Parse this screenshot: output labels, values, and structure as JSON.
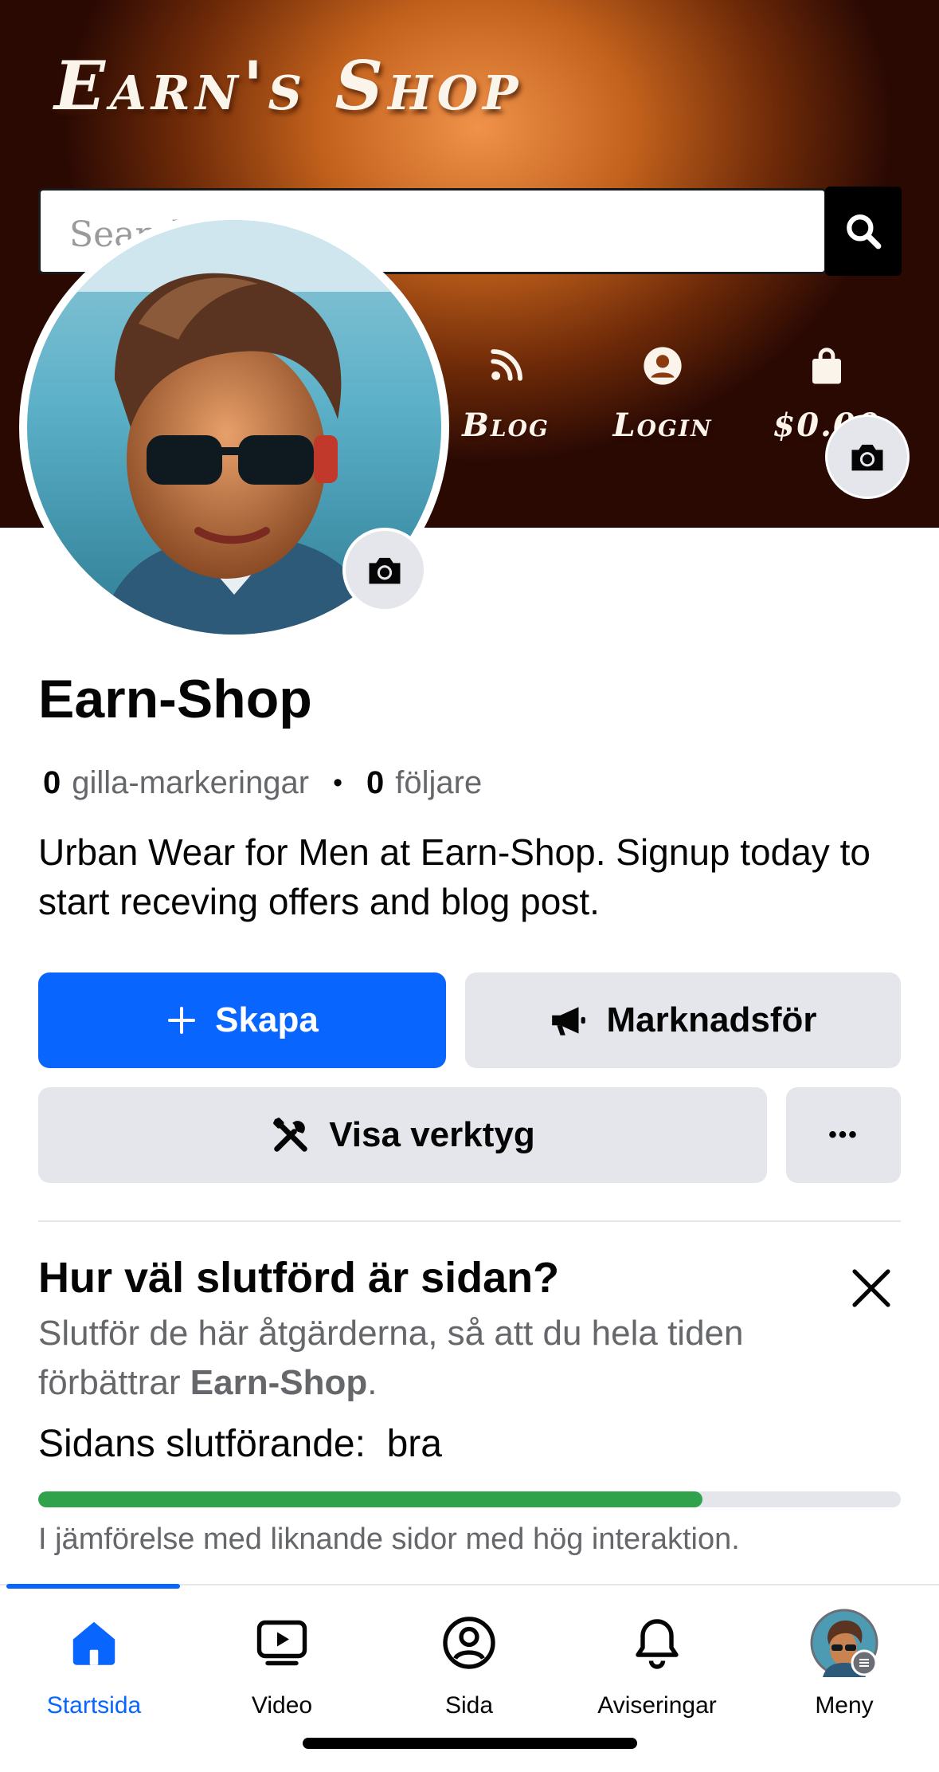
{
  "cover": {
    "title": "Earn's Shop",
    "search_placeholder": "Search",
    "nav": [
      {
        "label": "Blog",
        "icon": "rss-icon"
      },
      {
        "label": "Login",
        "icon": "user-circle-icon"
      },
      {
        "label": "$0.00",
        "icon": "shopping-bag-icon"
      }
    ]
  },
  "page": {
    "name": "Earn-Shop",
    "likes_count": "0",
    "likes_label": "gilla-markeringar",
    "followers_count": "0",
    "followers_label": "följare",
    "bio": "Urban Wear for Men at Earn-Shop. Signup today to start receving offers and blog post."
  },
  "actions": {
    "create_label": "Skapa",
    "promote_label": "Marknadsför",
    "tools_label": "Visa verktyg",
    "more_label": "•••"
  },
  "completion": {
    "title": "Hur väl slutförd är sidan?",
    "desc_prefix": "Slutför de här åtgärderna, så att du hela tiden förbättrar ",
    "desc_page": "Earn-Shop",
    "desc_suffix": ".",
    "status_label": "Sidans slutförande:",
    "status_value": "bra",
    "progress": 0.77,
    "note": "I jämförelse med liknande sidor med hög interaktion."
  },
  "tabs": [
    {
      "label": "Startsida",
      "icon": "home-icon",
      "active": true
    },
    {
      "label": "Video",
      "icon": "video-icon",
      "active": false
    },
    {
      "label": "Sida",
      "icon": "page-profile-icon",
      "active": false
    },
    {
      "label": "Aviseringar",
      "icon": "bell-icon",
      "active": false
    },
    {
      "label": "Meny",
      "icon": "menu-avatar-icon",
      "active": false
    }
  ],
  "colors": {
    "accent": "#0866ff",
    "progress": "#31a24c",
    "secondary_text": "#65676b",
    "button_grey": "#e4e6eb"
  }
}
